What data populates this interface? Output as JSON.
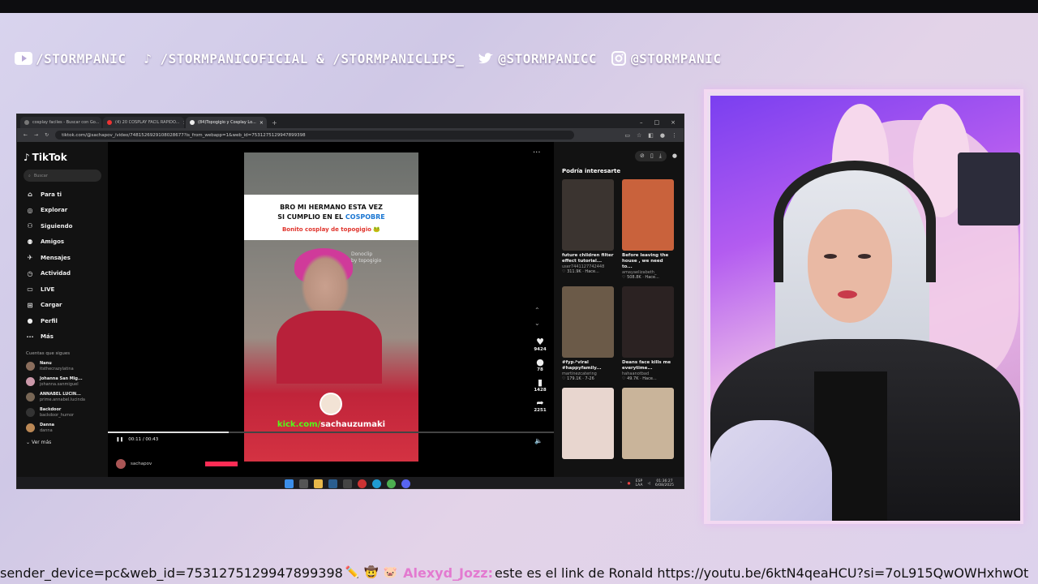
{
  "socials": {
    "youtube": "/STORMPANIC",
    "tiktok": "/STORMPANICOFICIAL & /STORMPANICLIPS_",
    "twitter": "@STORMPANICC",
    "instagram": "@STORMPANIC"
  },
  "browser": {
    "tabs": [
      {
        "label": "cosplay faciles - Buscar con Go..."
      },
      {
        "label": "(4) 20 COSPLAY FACIL RAPIDO..."
      },
      {
        "label": "(84)Topogigio y Cosplay Lo..."
      }
    ],
    "url": "tiktok.com/@sachapov_/video/7481526929108028677?is_from_webapp=1&web_id=7531275129947899398"
  },
  "tiktok": {
    "logo": "TikTok",
    "search_placeholder": "Buscar",
    "nav": [
      {
        "label": "Para ti",
        "icon": "home-icon"
      },
      {
        "label": "Explorar",
        "icon": "compass-icon"
      },
      {
        "label": "Siguiendo",
        "icon": "following-icon"
      },
      {
        "label": "Amigos",
        "icon": "friends-icon"
      },
      {
        "label": "Mensajes",
        "icon": "messages-icon"
      },
      {
        "label": "Actividad",
        "icon": "activity-icon"
      },
      {
        "label": "LIVE",
        "icon": "live-icon"
      },
      {
        "label": "Cargar",
        "icon": "upload-icon"
      },
      {
        "label": "Perfil",
        "icon": "profile-icon"
      },
      {
        "label": "Más",
        "icon": "more-icon"
      }
    ],
    "following_title": "Cuentas que sigues",
    "following": [
      {
        "name": "Nanu",
        "handle": "itsthecrazylatina"
      },
      {
        "name": "Johanna San Mig...",
        "handle": "johanna.sanmiguel"
      },
      {
        "name": "ANNABEL LUCIN...",
        "handle": "prime.annabel.lucinda"
      },
      {
        "name": "Backdoor",
        "handle": "backdoor_humor"
      },
      {
        "name": "Danna",
        "handle": "danna"
      }
    ],
    "see_more": "Ver más",
    "video": {
      "headline_1": "BRO MI HERMANO ESTA VEZ",
      "headline_2a": "SI CUMPLIO EN EL ",
      "headline_2b": "COSPOBRE",
      "subline": "Bonito cosplay de topogigio",
      "clip_1": "Donoclip",
      "clip_2": "by topogigio",
      "kick_a": "kick.com/",
      "kick_b": "sachauzumaki",
      "time": "00:11 / 00:43",
      "progress": 0.27
    },
    "actions": [
      {
        "icon": "heart-icon",
        "count": "9424"
      },
      {
        "icon": "comment-icon",
        "count": "78"
      },
      {
        "icon": "bookmark-icon",
        "count": "1428"
      },
      {
        "icon": "share-icon",
        "count": "2251"
      }
    ],
    "author": "sachapov",
    "interest_title": "Podría interesarte",
    "cards": [
      {
        "title": "future children filter effect tutorial...",
        "user": "user7441127742448",
        "stats": "♡ 311.9K · Hace...",
        "color": "#3b3430"
      },
      {
        "title": "Before leaving the house , we need to...",
        "user": "amayaelizabeth_",
        "stats": "♡ 508.8K · Hace...",
        "color": "#c9623c"
      },
      {
        "title": "#fyp↗viral #happyfamily...",
        "user": "martinezcatering",
        "stats": "♡ 179.1K · 7-26",
        "color": "#6b5a48"
      },
      {
        "title": "Deans face kills me everytime...",
        "user": "hahaanotbad",
        "stats": "♡ 49.7K · Hace...",
        "color": "#2b2222"
      },
      {
        "title": "",
        "user": "",
        "stats": "",
        "color": "#e8d6cf"
      },
      {
        "title": "",
        "user": "",
        "stats": "",
        "color": "#c9b49a"
      }
    ]
  },
  "taskbar": {
    "lang_1": "ESP",
    "lang_2": "LAA",
    "time": "01:36:27",
    "date": "6/08/2025"
  },
  "chat": {
    "prefix": "sender_device=pc&web_id=7531275129947899398",
    "user": "Alexyd_Jozz:",
    "message": "este es el link de Ronald https://youtu.be/6ktN4qeaHCU?si=7oL915QwOWHxhwOt"
  }
}
